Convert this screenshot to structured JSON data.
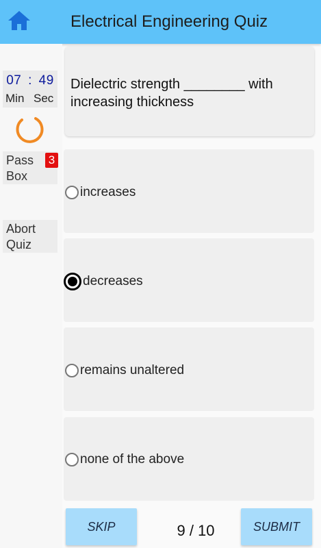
{
  "header": {
    "title": "Electrical Engineering Quiz",
    "home_icon": "home-icon",
    "accent": "#5ec2f9",
    "icon_color": "#1a6fd8"
  },
  "sidebar": {
    "timer": {
      "minutes": "07",
      "separator": ":",
      "seconds": "49",
      "min_label": "Min",
      "sec_label": "Sec"
    },
    "spinner_color": "#f08a24",
    "pass_box": {
      "line1": "Pass",
      "line2": "Box",
      "count": "3"
    },
    "abort": {
      "line1": "Abort",
      "line2": "Quiz"
    }
  },
  "question": {
    "text": "Dielectric strength ________ with increasing thickness"
  },
  "options": [
    {
      "label": "increases",
      "selected": false
    },
    {
      "label": "decreases",
      "selected": true
    },
    {
      "label": "remains unaltered",
      "selected": false
    },
    {
      "label": "none of the above",
      "selected": false
    }
  ],
  "footer": {
    "skip_label": "SKIP",
    "submit_label": "SUBMIT",
    "progress": "9 / 10"
  }
}
